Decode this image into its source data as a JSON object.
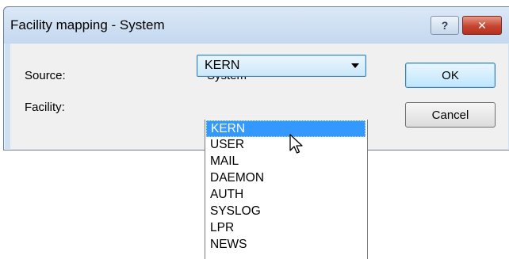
{
  "window": {
    "title": "Facility mapping - System",
    "help_glyph": "?",
    "close_glyph": "✕"
  },
  "form": {
    "source_label": "Source:",
    "source_value": "System",
    "facility_label": "Facility:",
    "facility_value": "KERN"
  },
  "buttons": {
    "ok": "OK",
    "cancel": "Cancel"
  },
  "dropdown": {
    "options": [
      "KERN",
      "USER",
      "MAIL",
      "DAEMON",
      "AUTH",
      "SYSLOG",
      "LPR",
      "NEWS"
    ],
    "selected": "KERN",
    "highlight_color": "#3399ff"
  },
  "icons": {
    "cursor": "arrow-pointer-icon"
  }
}
